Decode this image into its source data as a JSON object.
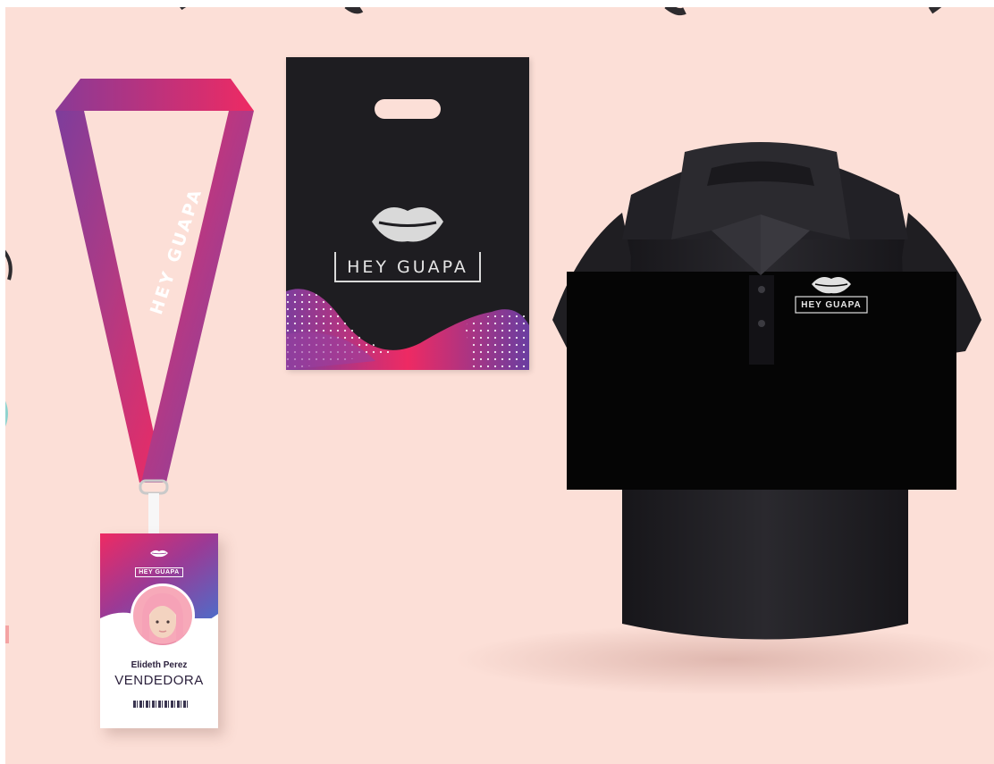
{
  "brand": {
    "name": "HEY GUAPA",
    "colors": {
      "background": "#fcdfd7",
      "gradient_pink": "#ee2a63",
      "gradient_purple": "#6a3ea1",
      "black": "#1e1d21",
      "logo_silver": "#d9d9d9"
    }
  },
  "lanyard": {
    "strap_text": "HEY GUAPA"
  },
  "id_card": {
    "logo_text": "HEY GUAPA",
    "name": "Elideth Perez",
    "role": "VENDEDORA"
  },
  "bag": {
    "logo_text": "HEY GUAPA"
  },
  "shirt": {
    "logo_text": "HEY GUAPA"
  },
  "icons": [
    "lips-icon"
  ]
}
